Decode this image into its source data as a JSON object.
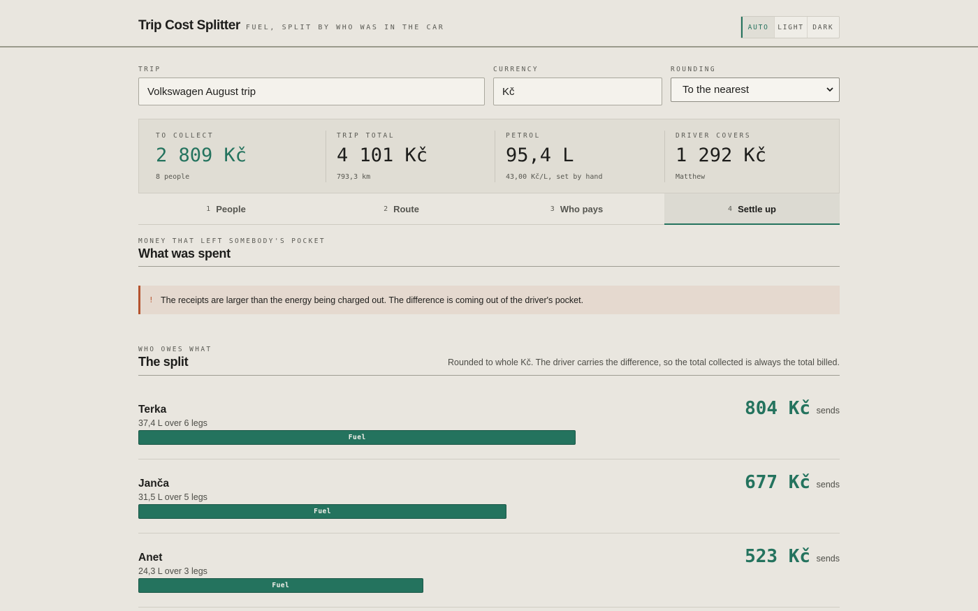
{
  "header": {
    "title": "Trip Cost Splitter",
    "subtitle": "FUEL, SPLIT BY WHO WAS IN THE CAR",
    "theme_options": [
      "AUTO",
      "LIGHT",
      "DARK"
    ],
    "theme_selected": "AUTO"
  },
  "form": {
    "trip_label": "TRIP",
    "trip_value": "Volkswagen August trip",
    "currency_label": "CURRENCY",
    "currency_value": "Kč",
    "rounding_label": "ROUNDING",
    "rounding_value": "To the nearest"
  },
  "stats": [
    {
      "label": "TO COLLECT",
      "value": "2 809 Kč",
      "note": "8 people",
      "accent": true
    },
    {
      "label": "TRIP TOTAL",
      "value": "4 101 Kč",
      "note": "793,3 km",
      "accent": false
    },
    {
      "label": "PETROL",
      "value": "95,4 L",
      "note": "43,00 Kč/L, set by hand",
      "accent": false
    },
    {
      "label": "DRIVER COVERS",
      "value": "1 292 Kč",
      "note": "Matthew",
      "accent": false
    }
  ],
  "tabs": [
    {
      "num": "1",
      "label": "People"
    },
    {
      "num": "2",
      "label": "Route"
    },
    {
      "num": "3",
      "label": "Who pays"
    },
    {
      "num": "4",
      "label": "Settle up"
    }
  ],
  "active_tab": 3,
  "spent_section": {
    "eyebrow": "MONEY THAT LEFT SOMEBODY'S POCKET",
    "heading": "What was spent"
  },
  "warning": {
    "icon": "!",
    "text": "The receipts are larger than the energy being charged out. The difference is coming out of the driver's pocket."
  },
  "split_section": {
    "eyebrow": "WHO OWES WHAT",
    "heading": "The split",
    "note": "Rounded to whole Kč. The driver carries the difference, so the total collected is always the total billed."
  },
  "split_rows": [
    {
      "name": "Terka",
      "detail": "37,4 L over 6 legs",
      "amount": "804 Kč",
      "verb": "sends",
      "bar_label": "Fuel",
      "share": 0.624
    },
    {
      "name": "Janča",
      "detail": "31,5 L over 5 legs",
      "amount": "677 Kč",
      "verb": "sends",
      "bar_label": "Fuel",
      "share": 0.525
    },
    {
      "name": "Anet",
      "detail": "24,3 L over 3 legs",
      "amount": "523 Kč",
      "verb": "sends",
      "bar_label": "Fuel",
      "share": 0.406
    }
  ],
  "colors": {
    "accent": "#24735e",
    "warning": "#b5532e",
    "background": "#e9e6df"
  }
}
